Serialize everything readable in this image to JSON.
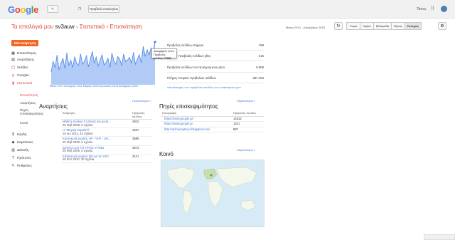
{
  "topbar": {
    "logo": "Google",
    "view_blog_button": "Προβολή ιστολογίου",
    "user_name": "Τάσος"
  },
  "header": {
    "my_blogs": "Τα ιστολόγιά μου",
    "blog_name": "sv3auw",
    "sep1": "›",
    "section": "Στατιστικά",
    "sep2": "›",
    "page": "Επισκόπηση",
    "date_range": "Μάιος 2010 – Δεκέμβριος 2015",
    "periods": [
      "Τώρα",
      "Ημέρα",
      "Εβδομάδα",
      "Μήνας",
      "Συνεχώς"
    ],
    "active_period": "Συνεχώς"
  },
  "sidebar": {
    "new_post": "Νέα ανάρτηση",
    "items": [
      {
        "label": "Επισκόπηση",
        "icon": "home-icon"
      },
      {
        "label": "Αναρτήσεις",
        "icon": "posts-icon"
      },
      {
        "label": "Σελίδες",
        "icon": "pages-icon"
      },
      {
        "label": "Google+",
        "icon": "googleplus-icon"
      },
      {
        "label": "Στατιστικά",
        "icon": "stats-icon"
      }
    ],
    "stats_sub": [
      "Επισκόπηση",
      "Αναρτήσεις",
      "Πηγές επισκεψιμότητας",
      "Κοινό"
    ],
    "items2": [
      {
        "label": "Κέρδη",
        "icon": "earnings-icon"
      },
      {
        "label": "Καμπάνιες",
        "icon": "campaigns-icon"
      },
      {
        "label": "Διάταξη",
        "icon": "layout-icon"
      },
      {
        "label": "Πρότυπο",
        "icon": "template-icon"
      },
      {
        "label": "Ρυθμίσεις",
        "icon": "settings-icon"
      }
    ]
  },
  "chart_data": {
    "type": "area",
    "title": "",
    "x_labels": [
      "Μάιος 2010",
      "Οκτώβριος 2011",
      "Μάρτιος 2013",
      "Αύγουστος 2014",
      "Δεκέμβριος 2015"
    ],
    "values": [
      30,
      55,
      40,
      70,
      35,
      50,
      62,
      38,
      75,
      45,
      58,
      40,
      66,
      50,
      45,
      72,
      48,
      55,
      68,
      42,
      60,
      78,
      50,
      65,
      44,
      58,
      70,
      46,
      52,
      62,
      40,
      74,
      56,
      48,
      66,
      60,
      45,
      72,
      54,
      58,
      64,
      50,
      76,
      48,
      60,
      70,
      52,
      90,
      66,
      82,
      70,
      86,
      74,
      100
    ],
    "color": "#a4c2f4",
    "line_color": "#4a86e8",
    "tooltip": {
      "date": "Δεκέμβριος 2015",
      "label": "Προβολές σελίδας:",
      "value": "7.030"
    }
  },
  "stats": {
    "rows": [
      {
        "label": "Προβολές σελίδων σήμερα",
        "value": "158"
      },
      {
        "label": "Προβολές σελίδων χθες",
        "value": "315"
      },
      {
        "label": "Προβολές σελίδων τον προηγούμενο μήνα",
        "value": "6.809"
      },
      {
        "label": "Πλήρες ιστορικό προβολών σελίδων",
        "value": "257.453"
      }
    ],
    "note": "Αποκλεισμός των προβολών σελίδας των επισκέψεών μου"
  },
  "posts": {
    "title": "Αναρτήσεις",
    "more": "Περισσότερα »",
    "col_post": "Ανάρτηση",
    "col_views": "Προβολές σελίδας",
    "rows": [
      {
        "title": "Μάθετε Κώδικα 5 απλούς και μονά...",
        "date": "25 Φεβ 2008, 6 σχόλια",
        "views": "4942"
      },
      {
        "title": "Η \"Μαγική Κεραία\"®",
        "date": "15 Ιαν 2012, 44 σχόλια",
        "views": "4497"
      },
      {
        "title": "Κατασκευή κεραίας HF - VHF - UH...",
        "date": "26 Φεβ 2008, 5 σχόλια",
        "views": "3686"
      },
      {
        "title": "ΔΙΠΟΛΑ ΚΑΙ ΤΟ ΥΨΟΣ ΑΥΤΩΝ",
        "date": "25 Φεβ 2008, 5 σχόλια",
        "views": "3373"
      },
      {
        "title": "Κατασκευή κεραίας 5/8 για τα VHF!",
        "date": "16 Σεπ 2010, 30 σχόλια",
        "views": "3141"
      }
    ]
  },
  "traffic": {
    "title": "Πηγές επισκεψιμότητας",
    "more": "Περισσότερα »",
    "col_ref": "Καταγραφή",
    "col_views": "Προβολές σελίδας",
    "rows": [
      {
        "url": "https://www.google.gr/",
        "views": "14332"
      },
      {
        "url": "https://www.google.gr",
        "views": "1431"
      },
      {
        "url": "http://archaeopteryx.blogspot.com/",
        "views": "897"
      }
    ]
  },
  "audience": {
    "title": "Κοινό",
    "more": "Περισσότερα »"
  },
  "colors": {
    "accent": "#dd4b39",
    "primary_button": "#f26522",
    "link": "#3c78d8"
  }
}
